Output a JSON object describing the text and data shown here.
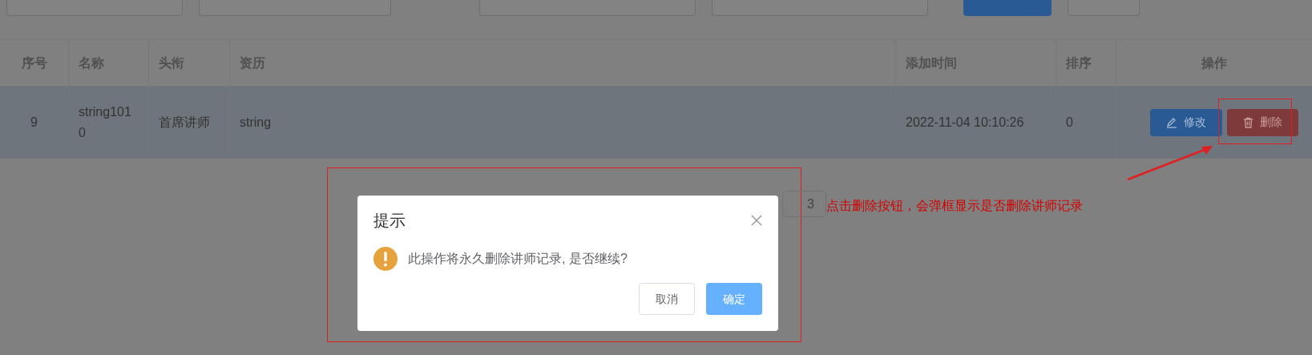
{
  "search_bar": [
    {
      "kind": "field"
    },
    {
      "kind": "field"
    },
    {
      "kind": "date_field"
    },
    {
      "kind": "date_field"
    },
    {
      "kind": "primary_button"
    },
    {
      "kind": "button"
    }
  ],
  "table": {
    "columns": [
      "序号",
      "名称",
      "头衔",
      "资历",
      "添加时间",
      "排序",
      "操作"
    ],
    "rows": [
      {
        "selected": true,
        "cells": [
          "9",
          "string1010",
          "首席讲师",
          "string",
          "2022-11-04 10:10:26",
          "0"
        ],
        "actions": [
          {
            "kind": "edit",
            "label": "修改"
          },
          {
            "kind": "delete",
            "label": "删除"
          }
        ]
      }
    ]
  },
  "pagination": {
    "page": "3"
  },
  "dialog": {
    "title": "提示",
    "message": "此操作将永久删除讲师记录, 是否继续?",
    "buttons": [
      {
        "kind": "secondary",
        "label": "取消"
      },
      {
        "kind": "primary",
        "label": "确定"
      }
    ]
  },
  "annotation": {
    "text": "点击删除按钮，会弹框显示是否删除讲师记录"
  }
}
